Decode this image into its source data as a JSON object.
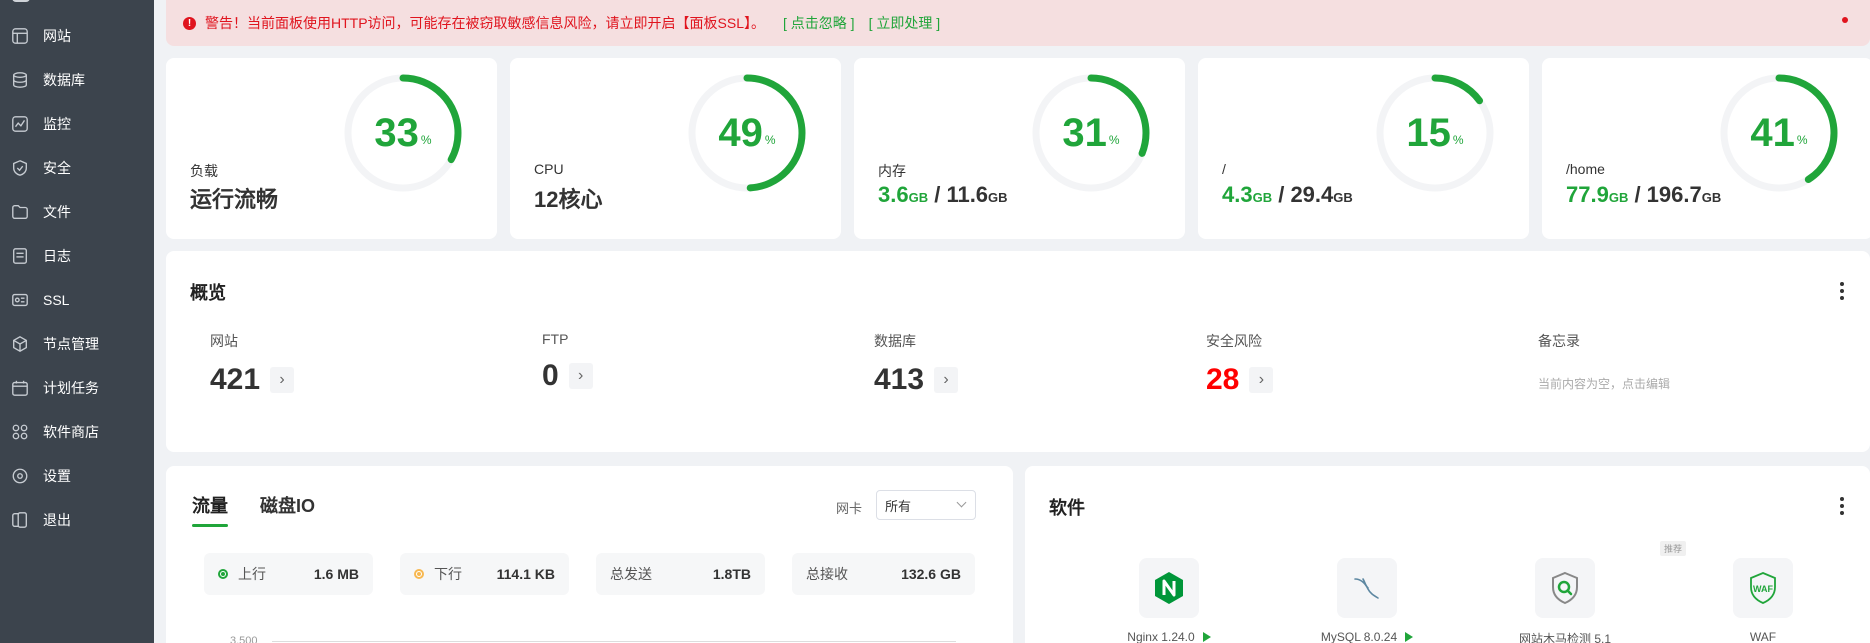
{
  "sidebar": {
    "items": [
      {
        "label": "网站",
        "icon": "website-icon"
      },
      {
        "label": "数据库",
        "icon": "database-icon"
      },
      {
        "label": "监控",
        "icon": "monitor-icon"
      },
      {
        "label": "安全",
        "icon": "shield-icon"
      },
      {
        "label": "文件",
        "icon": "folder-icon"
      },
      {
        "label": "日志",
        "icon": "log-icon"
      },
      {
        "label": "SSL",
        "icon": "ssl-icon"
      },
      {
        "label": "节点管理",
        "icon": "cube-icon"
      },
      {
        "label": "计划任务",
        "icon": "calendar-icon"
      },
      {
        "label": "软件商店",
        "icon": "apps-icon"
      },
      {
        "label": "设置",
        "icon": "gear-icon"
      },
      {
        "label": "退出",
        "icon": "logout-icon"
      }
    ]
  },
  "warning": {
    "text": "警告！当前面板使用HTTP访问，可能存在被窃取敏感信息风险，请立即开启【面板SSL】。",
    "ignore": "[ 点击忽略 ]",
    "fix": "[ 立即处理 ]",
    "color": "#e0141e"
  },
  "stats": [
    {
      "label": "负载",
      "percent": 33,
      "unit": "%",
      "status": "运行流畅"
    },
    {
      "label": "CPU",
      "percent": 49,
      "unit": "%",
      "status": "12核心"
    },
    {
      "label": "内存",
      "percent": 31,
      "unit": "%",
      "used": "3.6",
      "total": "11.6",
      "size_unit": "GB"
    },
    {
      "label": "/",
      "percent": 15,
      "unit": "%",
      "used": "4.3",
      "total": "29.4",
      "size_unit": "GB"
    },
    {
      "label": "/home",
      "percent": 41,
      "unit": "%",
      "used": "77.9",
      "total": "196.7",
      "size_unit": "GB"
    }
  ],
  "overview": {
    "title": "概览",
    "items": [
      {
        "label": "网站",
        "value": "421"
      },
      {
        "label": "FTP",
        "value": "0"
      },
      {
        "label": "数据库",
        "value": "413"
      },
      {
        "label": "安全风险",
        "value": "28"
      }
    ],
    "memo": {
      "label": "备忘录",
      "empty": "当前内容为空，点击编辑"
    }
  },
  "traffic": {
    "tabs": [
      "流量",
      "磁盘IO"
    ],
    "nic_label": "网卡",
    "nic_value": "所有",
    "up_label": "上行",
    "up_value": "1.6 MB",
    "down_label": "下行",
    "down_value": "114.1 KB",
    "sent_label": "总发送",
    "sent_value": "1.8TB",
    "recv_label": "总接收",
    "recv_value": "132.6 GB",
    "ytick": "3,500"
  },
  "software": {
    "title": "软件",
    "recommend": "推荐",
    "items": [
      {
        "name": "Nginx 1.24.0",
        "icon": "nginx-icon"
      },
      {
        "name": "MySQL 8.0.24",
        "icon": "mysql-icon"
      },
      {
        "name": "网站木马检测 5.1",
        "icon": "malware-scan-icon"
      },
      {
        "name": "WAF",
        "icon": "waf-icon"
      }
    ]
  },
  "colors": {
    "accent": "#20a53a",
    "danger": "#ff0000",
    "sidebar": "#3c444d"
  }
}
